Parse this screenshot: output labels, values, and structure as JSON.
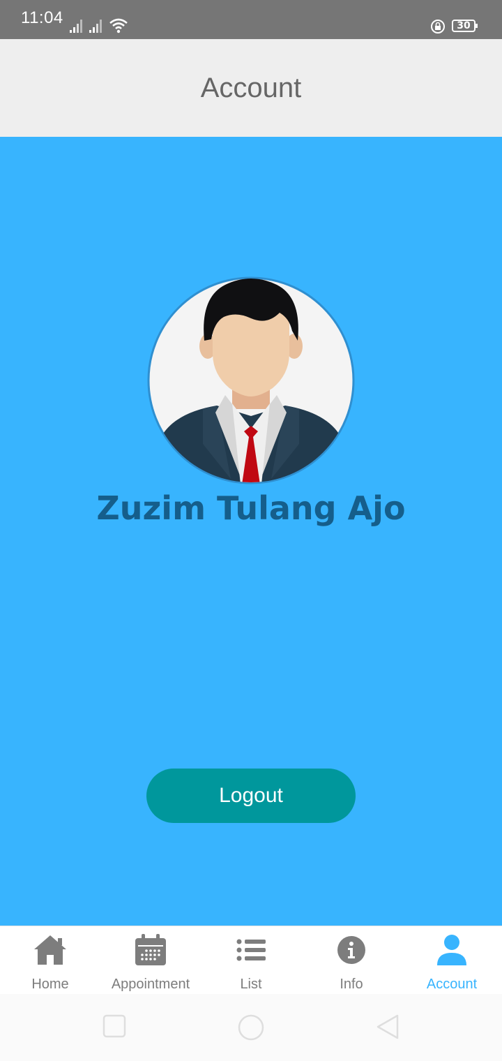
{
  "status_bar": {
    "time": "11:04",
    "battery": "30",
    "icons": [
      "signal-icon",
      "signal-icon",
      "wifi-icon",
      "rotation-lock-icon",
      "battery-icon"
    ]
  },
  "header": {
    "title": "Account"
  },
  "profile": {
    "name": "Zuzim Tulang Ajo",
    "avatar_icon": "businessman-avatar-icon"
  },
  "actions": {
    "logout_label": "Logout"
  },
  "bottom_nav": {
    "items": [
      {
        "label": "Home",
        "icon": "home-icon"
      },
      {
        "label": "Appointment",
        "icon": "calendar-icon"
      },
      {
        "label": "List",
        "icon": "list-icon"
      },
      {
        "label": "Info",
        "icon": "info-icon"
      },
      {
        "label": "Account",
        "icon": "person-icon"
      }
    ],
    "active": "Account"
  },
  "system_nav": {
    "icons": [
      "recents-square-icon",
      "home-circle-icon",
      "back-triangle-icon"
    ]
  },
  "colors": {
    "accent": "#38b4fe",
    "logout_button": "#00979c",
    "name_text": "#155e8b",
    "header_bg": "#eeeeee",
    "status_bar_bg": "#767676"
  }
}
